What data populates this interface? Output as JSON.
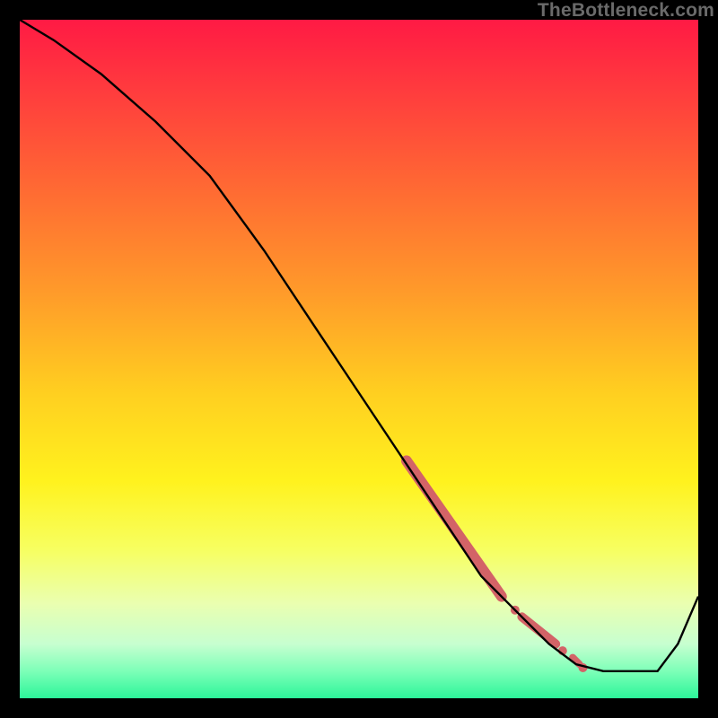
{
  "watermark": "TheBottleneck.com",
  "colors": {
    "frame": "#000000",
    "line": "#000000",
    "marker": "#d36367",
    "gradient_stops": [
      {
        "offset": 0.0,
        "color": "#ff1a44"
      },
      {
        "offset": 0.1,
        "color": "#ff3a3e"
      },
      {
        "offset": 0.25,
        "color": "#ff6a33"
      },
      {
        "offset": 0.4,
        "color": "#ff9a2a"
      },
      {
        "offset": 0.55,
        "color": "#ffcf20"
      },
      {
        "offset": 0.68,
        "color": "#fff21e"
      },
      {
        "offset": 0.78,
        "color": "#f7ff60"
      },
      {
        "offset": 0.86,
        "color": "#eaffb0"
      },
      {
        "offset": 0.92,
        "color": "#c7ffd0"
      },
      {
        "offset": 0.96,
        "color": "#7dffb8"
      },
      {
        "offset": 1.0,
        "color": "#2cf59a"
      }
    ]
  },
  "chart_data": {
    "type": "line",
    "title": "",
    "xlabel": "",
    "ylabel": "",
    "xlim": [
      0,
      100
    ],
    "ylim": [
      0,
      100
    ],
    "series": [
      {
        "name": "curve",
        "x": [
          0,
          5,
          12,
          20,
          28,
          36,
          44,
          52,
          60,
          68,
          74,
          78,
          82,
          86,
          90,
          94,
          97,
          100
        ],
        "y": [
          100,
          97,
          92,
          85,
          77,
          66,
          54,
          42,
          30,
          18,
          12,
          8,
          5,
          4,
          4,
          4,
          8,
          15
        ]
      }
    ],
    "highlight_segments": [
      {
        "x0": 57,
        "y0": 35,
        "x1": 71,
        "y1": 15,
        "width": 12
      },
      {
        "x0": 74,
        "y0": 12,
        "x1": 79,
        "y1": 8,
        "width": 10
      },
      {
        "x0": 81.5,
        "y0": 6,
        "x1": 82.5,
        "y1": 5,
        "width": 8
      }
    ],
    "highlight_points": [
      {
        "x": 73,
        "y": 13,
        "r": 5
      },
      {
        "x": 80,
        "y": 7,
        "r": 5
      },
      {
        "x": 83,
        "y": 4.5,
        "r": 5
      }
    ]
  }
}
